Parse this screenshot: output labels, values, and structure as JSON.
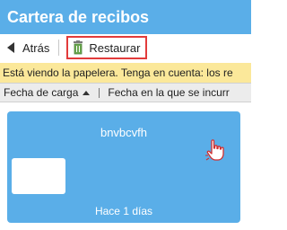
{
  "header": {
    "title": "Cartera de recibos"
  },
  "toolbar": {
    "back_label": "Atrás",
    "restore_label": "Restaurar"
  },
  "banner": {
    "text": "Está viendo la papelera. Tenga en cuenta: los re"
  },
  "sort": {
    "items": [
      {
        "label": "Fecha de carga"
      },
      {
        "label": "Fecha en la que se incurr"
      }
    ]
  },
  "cards": [
    {
      "title": "bnvbcvfh",
      "date": "Hace 1 días"
    }
  ],
  "colors": {
    "header_bg": "#5aaee8",
    "banner_bg": "#fbe89a",
    "card_bg": "#5aaee8",
    "highlight": "#e23b3b"
  },
  "icons": {
    "back": "arrow-left-icon",
    "restore": "trash-restore-icon",
    "sort": "caret-up-icon",
    "cursor": "hand-pointer-icon"
  }
}
